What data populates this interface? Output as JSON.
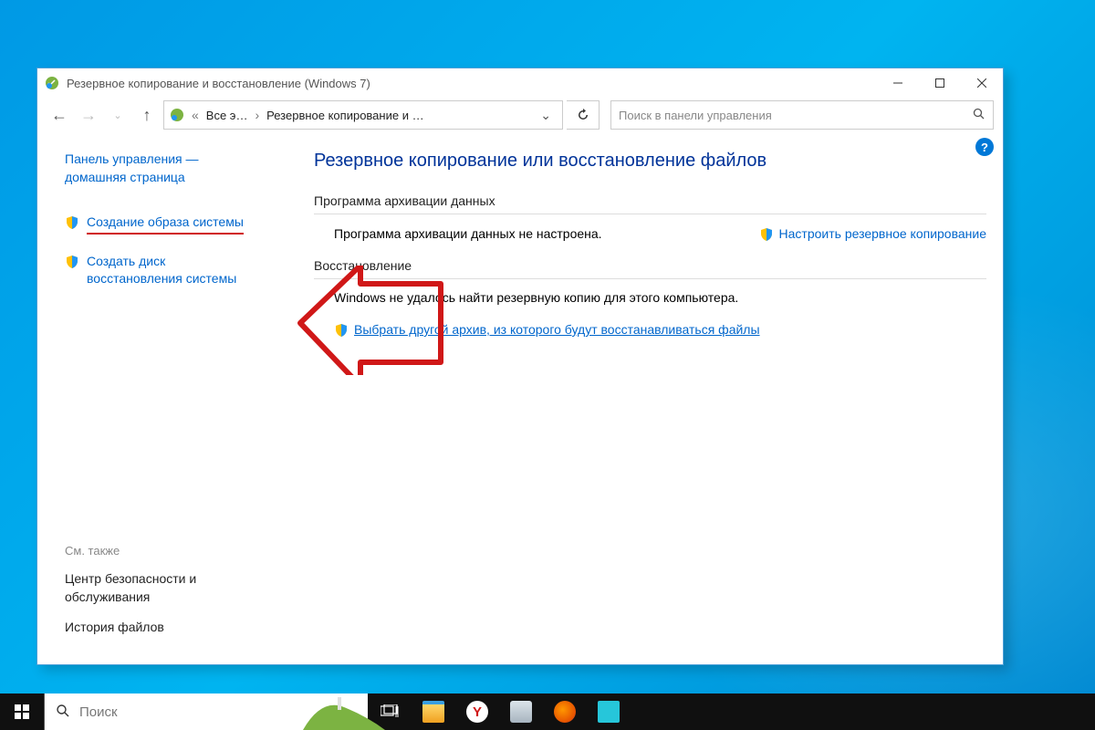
{
  "window": {
    "title": "Резервное копирование и восстановление (Windows 7)"
  },
  "address": {
    "crumb1": "Все э…",
    "crumb2": "Резервное копирование и …"
  },
  "search": {
    "placeholder": "Поиск в панели управления"
  },
  "sidebar": {
    "home": "Панель управления — домашняя страница",
    "item1": "Создание образа системы",
    "item2": "Создать диск восстановления системы",
    "see_also": "См. также",
    "link1": "Центр безопасности и обслуживания",
    "link2": "История файлов"
  },
  "main": {
    "title": "Резервное копирование или восстановление файлов",
    "section_backup": "Программа архивации данных",
    "backup_status": "Программа архивации данных не настроена.",
    "setup_link": "Настроить резервное копирование",
    "section_restore": "Восстановление",
    "restore_status": "Windows не удалось найти резервную копию для этого компьютера.",
    "restore_link": "Выбрать другой архив, из которого будут восстанавливаться файлы"
  },
  "taskbar": {
    "search_placeholder": "Поиск"
  }
}
